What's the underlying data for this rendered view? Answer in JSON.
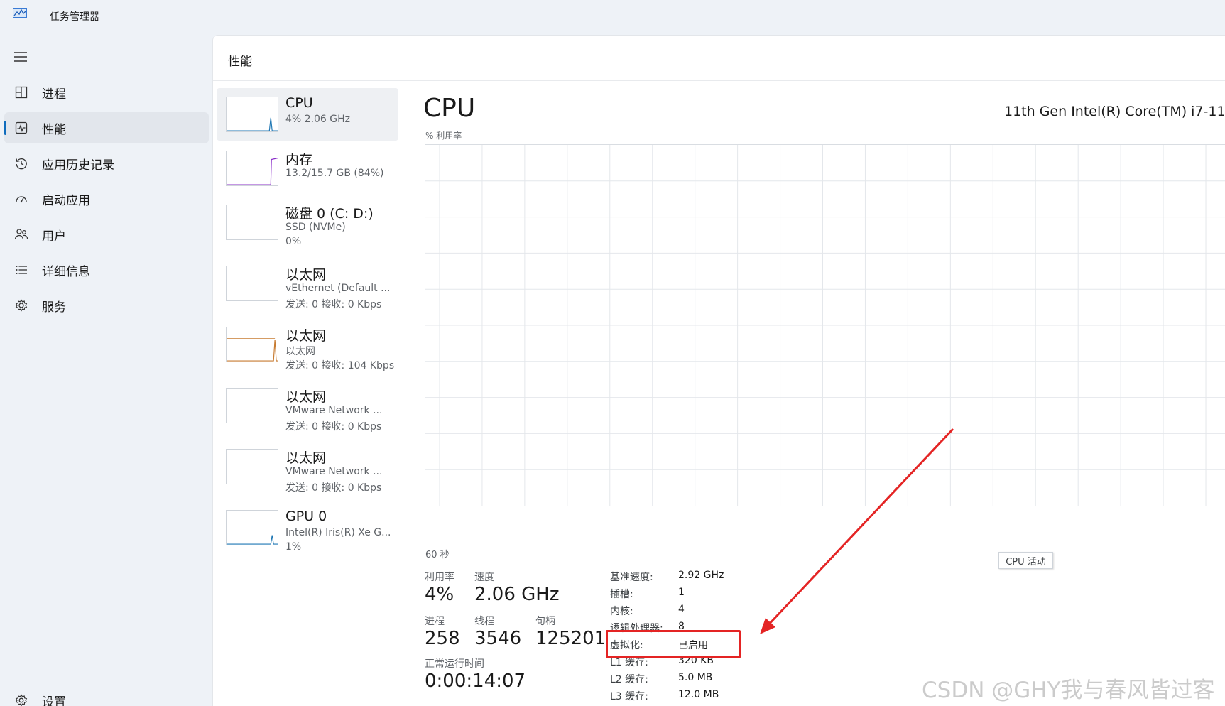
{
  "window": {
    "title": "任务管理器"
  },
  "sidebar": {
    "items": [
      {
        "label": "进程",
        "icon": "processes-icon",
        "active": false
      },
      {
        "label": "性能",
        "icon": "performance-icon",
        "active": true
      },
      {
        "label": "应用历史记录",
        "icon": "history-icon",
        "active": false
      },
      {
        "label": "启动应用",
        "icon": "startup-icon",
        "active": false
      },
      {
        "label": "用户",
        "icon": "users-icon",
        "active": false
      },
      {
        "label": "详细信息",
        "icon": "details-icon",
        "active": false
      },
      {
        "label": "服务",
        "icon": "services-icon",
        "active": false
      }
    ],
    "settings_label": "设置"
  },
  "page": {
    "title": "性能"
  },
  "devices": [
    {
      "name": "CPU",
      "line1": "4% 2.06 GHz",
      "line2": "",
      "color": "#1f77b4"
    },
    {
      "name": "内存",
      "line1": "13.2/15.7 GB (84%)",
      "line2": "",
      "color": "#8b2fc9"
    },
    {
      "name": "磁盘 0 (C: D:)",
      "line1": "SSD (NVMe)",
      "line2": "0%",
      "color": "#4caf50"
    },
    {
      "name": "以太网",
      "line1": "vEthernet (Default ...",
      "line2": "发送: 0 接收: 0 Kbps",
      "color": "#c77b30"
    },
    {
      "name": "以太网",
      "line1": "以太网",
      "line2": "发送: 0 接收: 104 Kbps",
      "color": "#c77b30"
    },
    {
      "name": "以太网",
      "line1": "VMware Network ...",
      "line2": "发送: 0 接收: 0 Kbps",
      "color": "#c77b30"
    },
    {
      "name": "以太网",
      "line1": "VMware Network ...",
      "line2": "发送: 0 接收: 0 Kbps",
      "color": "#c77b30"
    },
    {
      "name": "GPU 0",
      "line1": "Intel(R) Iris(R) Xe G...",
      "line2": "1%",
      "color": "#1f77b4"
    }
  ],
  "detail": {
    "title": "CPU",
    "model": "11th Gen Intel(R) Core(TM) i7-11",
    "util_label": "% 利用率",
    "axis_left": "60 秒",
    "activity_label": "CPU 活动",
    "stats": {
      "utilization_label": "利用率",
      "utilization": "4%",
      "speed_label": "速度",
      "speed": "2.06 GHz",
      "processes_label": "进程",
      "processes": "258",
      "threads_label": "线程",
      "threads": "3546",
      "handles_label": "句柄",
      "handles": "125201",
      "uptime_label": "正常运行时间",
      "uptime": "0:00:14:07"
    },
    "specs": [
      {
        "key": "基准速度:",
        "value": "2.92 GHz"
      },
      {
        "key": "插槽:",
        "value": "1"
      },
      {
        "key": "内核:",
        "value": "4"
      },
      {
        "key": "逻辑处理器:",
        "value": "8"
      },
      {
        "key": "虚拟化:",
        "value": "已启用"
      },
      {
        "key": "L1 缓存:",
        "value": "320 KB"
      },
      {
        "key": "L2 缓存:",
        "value": "5.0 MB"
      },
      {
        "key": "L3 缓存:",
        "value": "12.0 MB"
      }
    ]
  },
  "watermark": "CSDN @GHY我与春风皆过客",
  "colors": {
    "accent": "#0f6cbd",
    "highlight": "#e42424",
    "grid": "#e4e7eb"
  }
}
